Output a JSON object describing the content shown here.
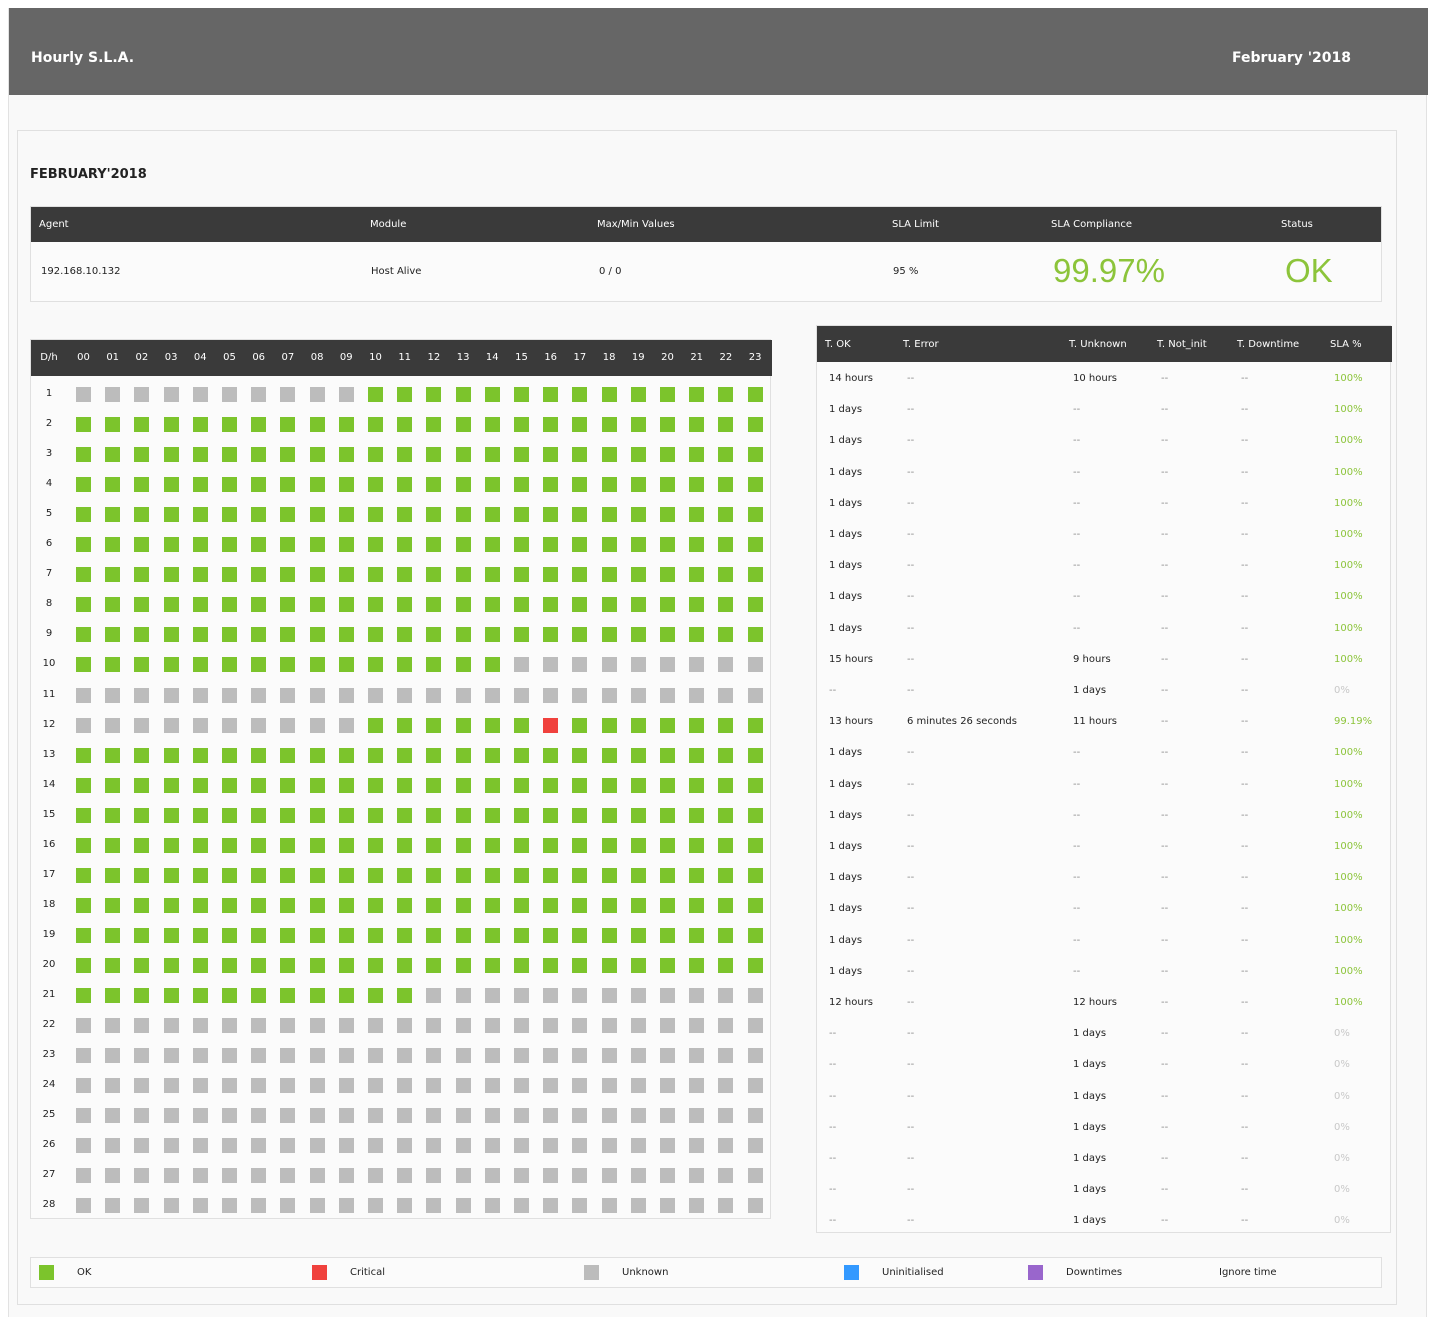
{
  "header": {
    "title": "Hourly S.L.A.",
    "month": "February '2018"
  },
  "section_title": "FEBRUARY'2018",
  "summary": {
    "columns": [
      "Agent",
      "Module",
      "Max/Min Values",
      "SLA Limit",
      "SLA Compliance",
      "Status"
    ],
    "agent": "192.168.10.132",
    "module": "Host Alive",
    "maxmin": "0 / 0",
    "sla_limit": "95 %",
    "sla_compliance": "99.97%",
    "status": "OK"
  },
  "grid": {
    "corner_label": "D/h",
    "hours": [
      "00",
      "01",
      "02",
      "03",
      "04",
      "05",
      "06",
      "07",
      "08",
      "09",
      "10",
      "11",
      "12",
      "13",
      "14",
      "15",
      "16",
      "17",
      "18",
      "19",
      "20",
      "21",
      "22",
      "23"
    ],
    "days": [
      {
        "label": "1",
        "cells": "UUUUUUUUUUOOOOOOOOOOOOOO"
      },
      {
        "label": "2",
        "cells": "OOOOOOOOOOOOOOOOOOOOOOOO"
      },
      {
        "label": "3",
        "cells": "OOOOOOOOOOOOOOOOOOOOOOOO"
      },
      {
        "label": "4",
        "cells": "OOOOOOOOOOOOOOOOOOOOOOOO"
      },
      {
        "label": "5",
        "cells": "OOOOOOOOOOOOOOOOOOOOOOOO"
      },
      {
        "label": "6",
        "cells": "OOOOOOOOOOOOOOOOOOOOOOOO"
      },
      {
        "label": "7",
        "cells": "OOOOOOOOOOOOOOOOOOOOOOOO"
      },
      {
        "label": "8",
        "cells": "OOOOOOOOOOOOOOOOOOOOOOOO"
      },
      {
        "label": "9",
        "cells": "OOOOOOOOOOOOOOOOOOOOOOOO"
      },
      {
        "label": "10",
        "cells": "OOOOOOOOOOOOOOOUUUUUUUUU"
      },
      {
        "label": "11",
        "cells": "UUUUUUUUUUUUUUUUUUUUUUUU"
      },
      {
        "label": "12",
        "cells": "UUUUUUUUUUOOOOOOCOOOOOOO"
      },
      {
        "label": "13",
        "cells": "OOOOOOOOOOOOOOOOOOOOOOOO"
      },
      {
        "label": "14",
        "cells": "OOOOOOOOOOOOOOOOOOOOOOOO"
      },
      {
        "label": "15",
        "cells": "OOOOOOOOOOOOOOOOOOOOOOOO"
      },
      {
        "label": "16",
        "cells": "OOOOOOOOOOOOOOOOOOOOOOOO"
      },
      {
        "label": "17",
        "cells": "OOOOOOOOOOOOOOOOOOOOOOOO"
      },
      {
        "label": "18",
        "cells": "OOOOOOOOOOOOOOOOOOOOOOOO"
      },
      {
        "label": "19",
        "cells": "OOOOOOOOOOOOOOOOOOOOOOOO"
      },
      {
        "label": "20",
        "cells": "OOOOOOOOOOOOOOOOOOOOOOOO"
      },
      {
        "label": "21",
        "cells": "OOOOOOOOOOOOUUUUUUUUUUUU"
      },
      {
        "label": "22",
        "cells": "UUUUUUUUUUUUUUUUUUUUUUUU"
      },
      {
        "label": "23",
        "cells": "UUUUUUUUUUUUUUUUUUUUUUUU"
      },
      {
        "label": "24",
        "cells": "UUUUUUUUUUUUUUUUUUUUUUUU"
      },
      {
        "label": "25",
        "cells": "UUUUUUUUUUUUUUUUUUUUUUUU"
      },
      {
        "label": "26",
        "cells": "UUUUUUUUUUUUUUUUUUUUUUUU"
      },
      {
        "label": "27",
        "cells": "UUUUUUUUUUUUUUUUUUUUUUUU"
      },
      {
        "label": "28",
        "cells": "UUUUUUUUUUUUUUUUUUUUUUUU"
      }
    ]
  },
  "stats": {
    "columns": [
      "T. OK",
      "T. Error",
      "T. Unknown",
      "T. Not_init",
      "T. Downtime",
      "SLA %"
    ],
    "rows": [
      [
        "14 hours",
        "--",
        "10 hours",
        "--",
        "--",
        "100%"
      ],
      [
        "1 days",
        "--",
        "--",
        "--",
        "--",
        "100%"
      ],
      [
        "1 days",
        "--",
        "--",
        "--",
        "--",
        "100%"
      ],
      [
        "1 days",
        "--",
        "--",
        "--",
        "--",
        "100%"
      ],
      [
        "1 days",
        "--",
        "--",
        "--",
        "--",
        "100%"
      ],
      [
        "1 days",
        "--",
        "--",
        "--",
        "--",
        "100%"
      ],
      [
        "1 days",
        "--",
        "--",
        "--",
        "--",
        "100%"
      ],
      [
        "1 days",
        "--",
        "--",
        "--",
        "--",
        "100%"
      ],
      [
        "1 days",
        "--",
        "--",
        "--",
        "--",
        "100%"
      ],
      [
        "15 hours",
        "--",
        "9 hours",
        "--",
        "--",
        "100%"
      ],
      [
        "--",
        "--",
        "1 days",
        "--",
        "--",
        "0%"
      ],
      [
        "13 hours",
        "6 minutes 26 seconds",
        "11 hours",
        "--",
        "--",
        "99.19%"
      ],
      [
        "1 days",
        "--",
        "--",
        "--",
        "--",
        "100%"
      ],
      [
        "1 days",
        "--",
        "--",
        "--",
        "--",
        "100%"
      ],
      [
        "1 days",
        "--",
        "--",
        "--",
        "--",
        "100%"
      ],
      [
        "1 days",
        "--",
        "--",
        "--",
        "--",
        "100%"
      ],
      [
        "1 days",
        "--",
        "--",
        "--",
        "--",
        "100%"
      ],
      [
        "1 days",
        "--",
        "--",
        "--",
        "--",
        "100%"
      ],
      [
        "1 days",
        "--",
        "--",
        "--",
        "--",
        "100%"
      ],
      [
        "1 days",
        "--",
        "--",
        "--",
        "--",
        "100%"
      ],
      [
        "12 hours",
        "--",
        "12 hours",
        "--",
        "--",
        "100%"
      ],
      [
        "--",
        "--",
        "1 days",
        "--",
        "--",
        "0%"
      ],
      [
        "--",
        "--",
        "1 days",
        "--",
        "--",
        "0%"
      ],
      [
        "--",
        "--",
        "1 days",
        "--",
        "--",
        "0%"
      ],
      [
        "--",
        "--",
        "1 days",
        "--",
        "--",
        "0%"
      ],
      [
        "--",
        "--",
        "1 days",
        "--",
        "--",
        "0%"
      ],
      [
        "--",
        "--",
        "1 days",
        "--",
        "--",
        "0%"
      ],
      [
        "--",
        "--",
        "1 days",
        "--",
        "--",
        "0%"
      ]
    ]
  },
  "legend": [
    {
      "label": "OK",
      "color": "#7cc42c"
    },
    {
      "label": "Critical",
      "color": "#f0413d"
    },
    {
      "label": "Unknown",
      "color": "#bcbcbc"
    },
    {
      "label": "Uninitialised",
      "color": "#3399ff"
    },
    {
      "label": "Downtimes",
      "color": "#9966cc"
    },
    {
      "label": "Ignore time",
      "color": ""
    }
  ],
  "colors": {
    "ok": "#7cc42c",
    "critical": "#f0413d",
    "unknown": "#bcbcbc",
    "accent_text": "#8cc43a",
    "header_bg": "#3a3a3a"
  }
}
